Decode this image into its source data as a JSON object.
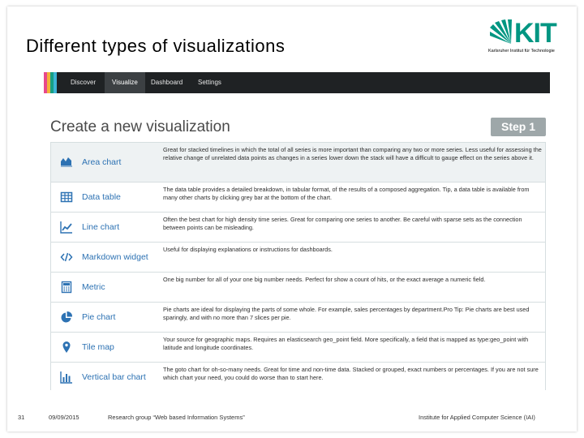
{
  "slide": {
    "title": "Different types of visualizations",
    "logo": {
      "text": "KIT",
      "subtitle": "Karlsruher Institut für Technologie",
      "color": "#009682"
    }
  },
  "app": {
    "nav": [
      {
        "label": "Discover"
      },
      {
        "label": "Visualize"
      },
      {
        "label": "Dashboard"
      },
      {
        "label": "Settings"
      }
    ],
    "active_tab": "Visualize",
    "heading": "Create a new visualization",
    "step": "Step 1",
    "visualizations": [
      {
        "name": "Area chart",
        "icon": "area-chart-icon",
        "description": "Great for stacked timelines in which the total of all series is more important than comparing any two or more series. Less useful for assessing the relative change of unrelated data points as changes in a series lower down the stack will have a difficult to gauge effect on the series above it."
      },
      {
        "name": "Data table",
        "icon": "table-icon",
        "description": "The data table provides a detailed breakdown, in tabular format, of the results of a composed aggregation. Tip, a data table is available from many other charts by clicking grey bar at the bottom of the chart."
      },
      {
        "name": "Line chart",
        "icon": "line-chart-icon",
        "description": "Often the best chart for high density time series. Great for comparing one series to another. Be careful with sparse sets as the connection between points can be misleading."
      },
      {
        "name": "Markdown widget",
        "icon": "code-icon",
        "description": "Useful for displaying explanations or instructions for dashboards."
      },
      {
        "name": "Metric",
        "icon": "calculator-icon",
        "description": "One big number for all of your one big number needs. Perfect for show a count of hits, or the exact average a numeric field."
      },
      {
        "name": "Pie chart",
        "icon": "pie-chart-icon",
        "description": "Pie charts are ideal for displaying the parts of some whole. For example, sales percentages by department.Pro Tip: Pie charts are best used sparingly, and with no more than 7 slices per pie."
      },
      {
        "name": "Tile map",
        "icon": "map-marker-icon",
        "description": "Your source for geographic maps. Requires an elasticsearch geo_point field. More specifically, a field that is mapped as type:geo_point with latitude and longitude coordinates."
      },
      {
        "name": "Vertical bar chart",
        "icon": "bar-chart-icon",
        "description": "The goto chart for oh-so-many needs. Great for time and non-time data. Stacked or grouped, exact numbers or percentages. If you are not sure which chart your need, you could do worse than to start here."
      }
    ]
  },
  "footer": {
    "page": "31",
    "date": "09/09/2015",
    "group": "Research group “Web based Information Systems”",
    "institute": "Institute for Applied Computer Science (IAI)"
  },
  "colors": {
    "navbar": "#1f2224",
    "link": "#2d72b3",
    "step_badge": "#9ea7a9",
    "stripes": [
      "#e8488b",
      "#f0b33a",
      "#16a085",
      "#3eb5d6"
    ]
  }
}
